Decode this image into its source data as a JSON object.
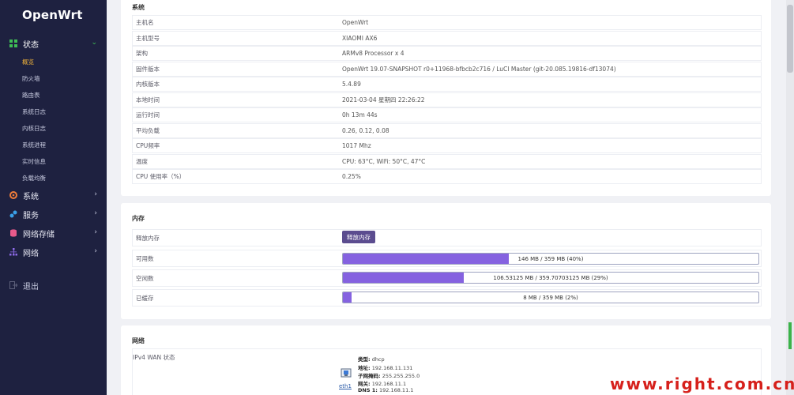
{
  "sidebar": {
    "logo": "OpenWrt",
    "status_label": "状态",
    "sub_items": [
      "概览",
      "防火墙",
      "路由表",
      "系统日志",
      "内核日志",
      "系统进程",
      "实时信息",
      "负载均衡"
    ],
    "system_label": "系统",
    "services_label": "服务",
    "nas_label": "网络存储",
    "network_label": "网络",
    "logout_label": "退出"
  },
  "system": {
    "title": "系统",
    "rows": [
      {
        "k": "主机名",
        "v": "OpenWrt"
      },
      {
        "k": "主机型号",
        "v": "XIAOMI AX6"
      },
      {
        "k": "架构",
        "v": "ARMv8 Processor x 4"
      },
      {
        "k": "固件版本",
        "v": "OpenWrt 19.07-SNAPSHOT r0+11968-bfbcb2c716 / LuCI Master (git-20.085.19816-df13074)"
      },
      {
        "k": "内核版本",
        "v": "5.4.89"
      },
      {
        "k": "本地时间",
        "v": "2021-03-04 星期四 22:26:22"
      },
      {
        "k": "运行时间",
        "v": "0h 13m 44s"
      },
      {
        "k": "平均负载",
        "v": "0.26, 0.12, 0.08"
      },
      {
        "k": "CPU频率",
        "v": "1017 Mhz"
      },
      {
        "k": "温度",
        "v": "CPU: 63°C, WiFi: 50°C, 47°C"
      },
      {
        "k": "CPU 使用率（%）",
        "v": "0.25%"
      }
    ]
  },
  "memory": {
    "title": "内存",
    "free_label": "释放内存",
    "free_button": "释放内存",
    "rows": [
      {
        "k": "可用数",
        "text": "146 MB / 359 MB (40%)",
        "percent": 40
      },
      {
        "k": "空闲数",
        "text": "106.53125 MB / 359.70703125 MB (29%)",
        "percent": 29
      },
      {
        "k": "已缓存",
        "text": "8 MB / 359 MB (2%)",
        "percent": 2
      }
    ]
  },
  "network": {
    "title": "网络",
    "wan_label": "IPv4 WAN 状态",
    "iface": "eth1",
    "lines": [
      {
        "k": "类型:",
        "v": "dhcp"
      },
      {
        "k": "地址:",
        "v": "192.168.11.131"
      },
      {
        "k": "子网掩码:",
        "v": "255.255.255.0"
      },
      {
        "k": "网关:",
        "v": "192.168.11.1"
      },
      {
        "k": "DNS 1:",
        "v": "192.168.11.1"
      }
    ]
  },
  "watermark": "www.right.com.cn",
  "colors": {
    "sidebar": "#1e2140",
    "accent": "#8562e0",
    "button": "#5b4c8f",
    "active": "#f0b23a"
  }
}
